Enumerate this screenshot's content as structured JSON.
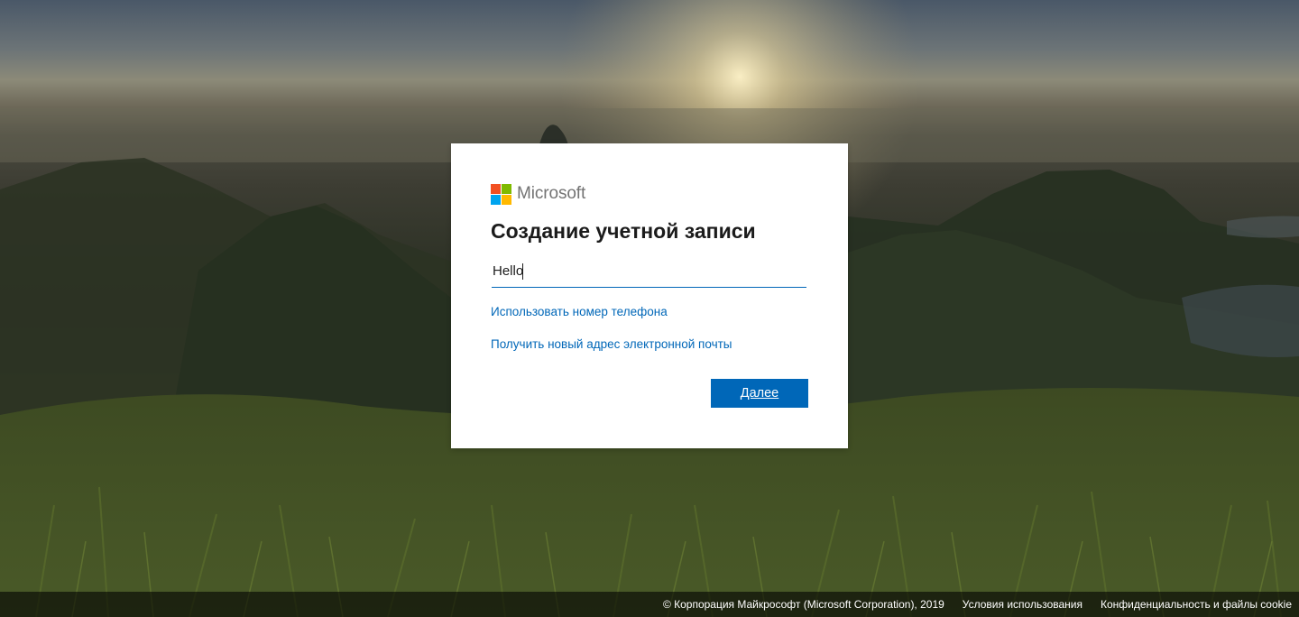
{
  "brand": {
    "name": "Microsoft",
    "logo_colors": [
      "#f25022",
      "#7fba00",
      "#00a4ef",
      "#ffb900"
    ]
  },
  "card": {
    "title": "Создание учетной записи",
    "email_input": {
      "value": "Hello",
      "placeholder": ""
    },
    "use_phone_link": "Использовать номер телефона",
    "new_email_link": "Получить новый адрес электронной почты",
    "next_button": "Далее"
  },
  "footer": {
    "copyright": "© Корпорация Майкрософт (Microsoft Corporation), 2019",
    "terms": "Условия использования",
    "privacy": "Конфиденциальность и файлы cookie"
  },
  "colors": {
    "accent": "#0067b8",
    "card_background": "#ffffff",
    "title_text": "#1b1b1b"
  }
}
